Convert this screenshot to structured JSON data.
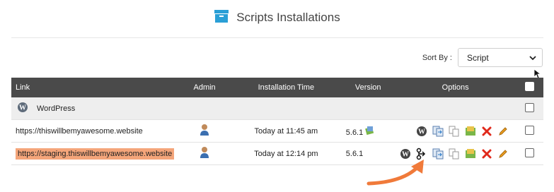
{
  "header": {
    "title": "Scripts Installations",
    "icon": "package-box-icon",
    "accent": "#2a9fd6"
  },
  "sort": {
    "label": "Sort By :",
    "selected": "Script"
  },
  "table": {
    "columns": {
      "link": "Link",
      "admin": "Admin",
      "time": "Installation Time",
      "version": "Version",
      "options": "Options"
    },
    "group": {
      "name": "WordPress"
    },
    "rows": [
      {
        "link": "https://thiswillbemyawesome.website",
        "time": "Today at 11:45 am",
        "version": "5.6.1",
        "highlighted": false
      },
      {
        "link": "https://staging.thiswillbemyawesome.website",
        "time": "Today at 12:14 pm",
        "version": "5.6.1",
        "highlighted": true
      }
    ]
  },
  "colors": {
    "header_bg": "#4a4a4a",
    "highlight": "#f4a57a",
    "arrow": "#f07a3a",
    "delete": "#e0291b"
  }
}
